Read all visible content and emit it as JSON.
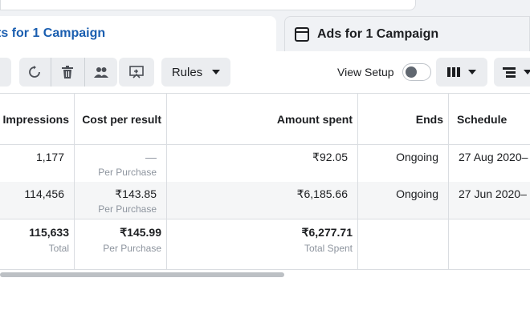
{
  "tabs": [
    {
      "label": "ts for 1 Campaign",
      "active": true
    },
    {
      "label": "Ads for 1 Campaign",
      "active": false
    }
  ],
  "toolbar": {
    "rules_label": "Rules",
    "view_setup_label": "View Setup",
    "view_setup_on": false
  },
  "table": {
    "headers": {
      "impressions": "Impressions",
      "cost_per_result": "Cost per result",
      "amount_spent": "Amount spent",
      "ends": "Ends",
      "schedule": "Schedule"
    },
    "rows": [
      {
        "impressions": "1,177",
        "cost": "—",
        "cost_sub": "Per Purchase",
        "amount": "₹92.05",
        "ends": "Ongoing",
        "schedule": "27 Aug 2020–"
      },
      {
        "impressions": "114,456",
        "cost": "₹143.85",
        "cost_sub": "Per Purchase",
        "amount": "₹6,185.66",
        "ends": "Ongoing",
        "schedule": "27 Jun 2020–"
      }
    ],
    "totals": {
      "impressions": "115,633",
      "impressions_sub": "Total",
      "cost": "₹145.99",
      "cost_sub": "Per Purchase",
      "amount": "₹6,277.71",
      "amount_sub": "Total Spent"
    }
  },
  "colors": {
    "accent": "#1a5eb0",
    "row_alt": "#f5f6f7",
    "border": "#dadde1"
  }
}
